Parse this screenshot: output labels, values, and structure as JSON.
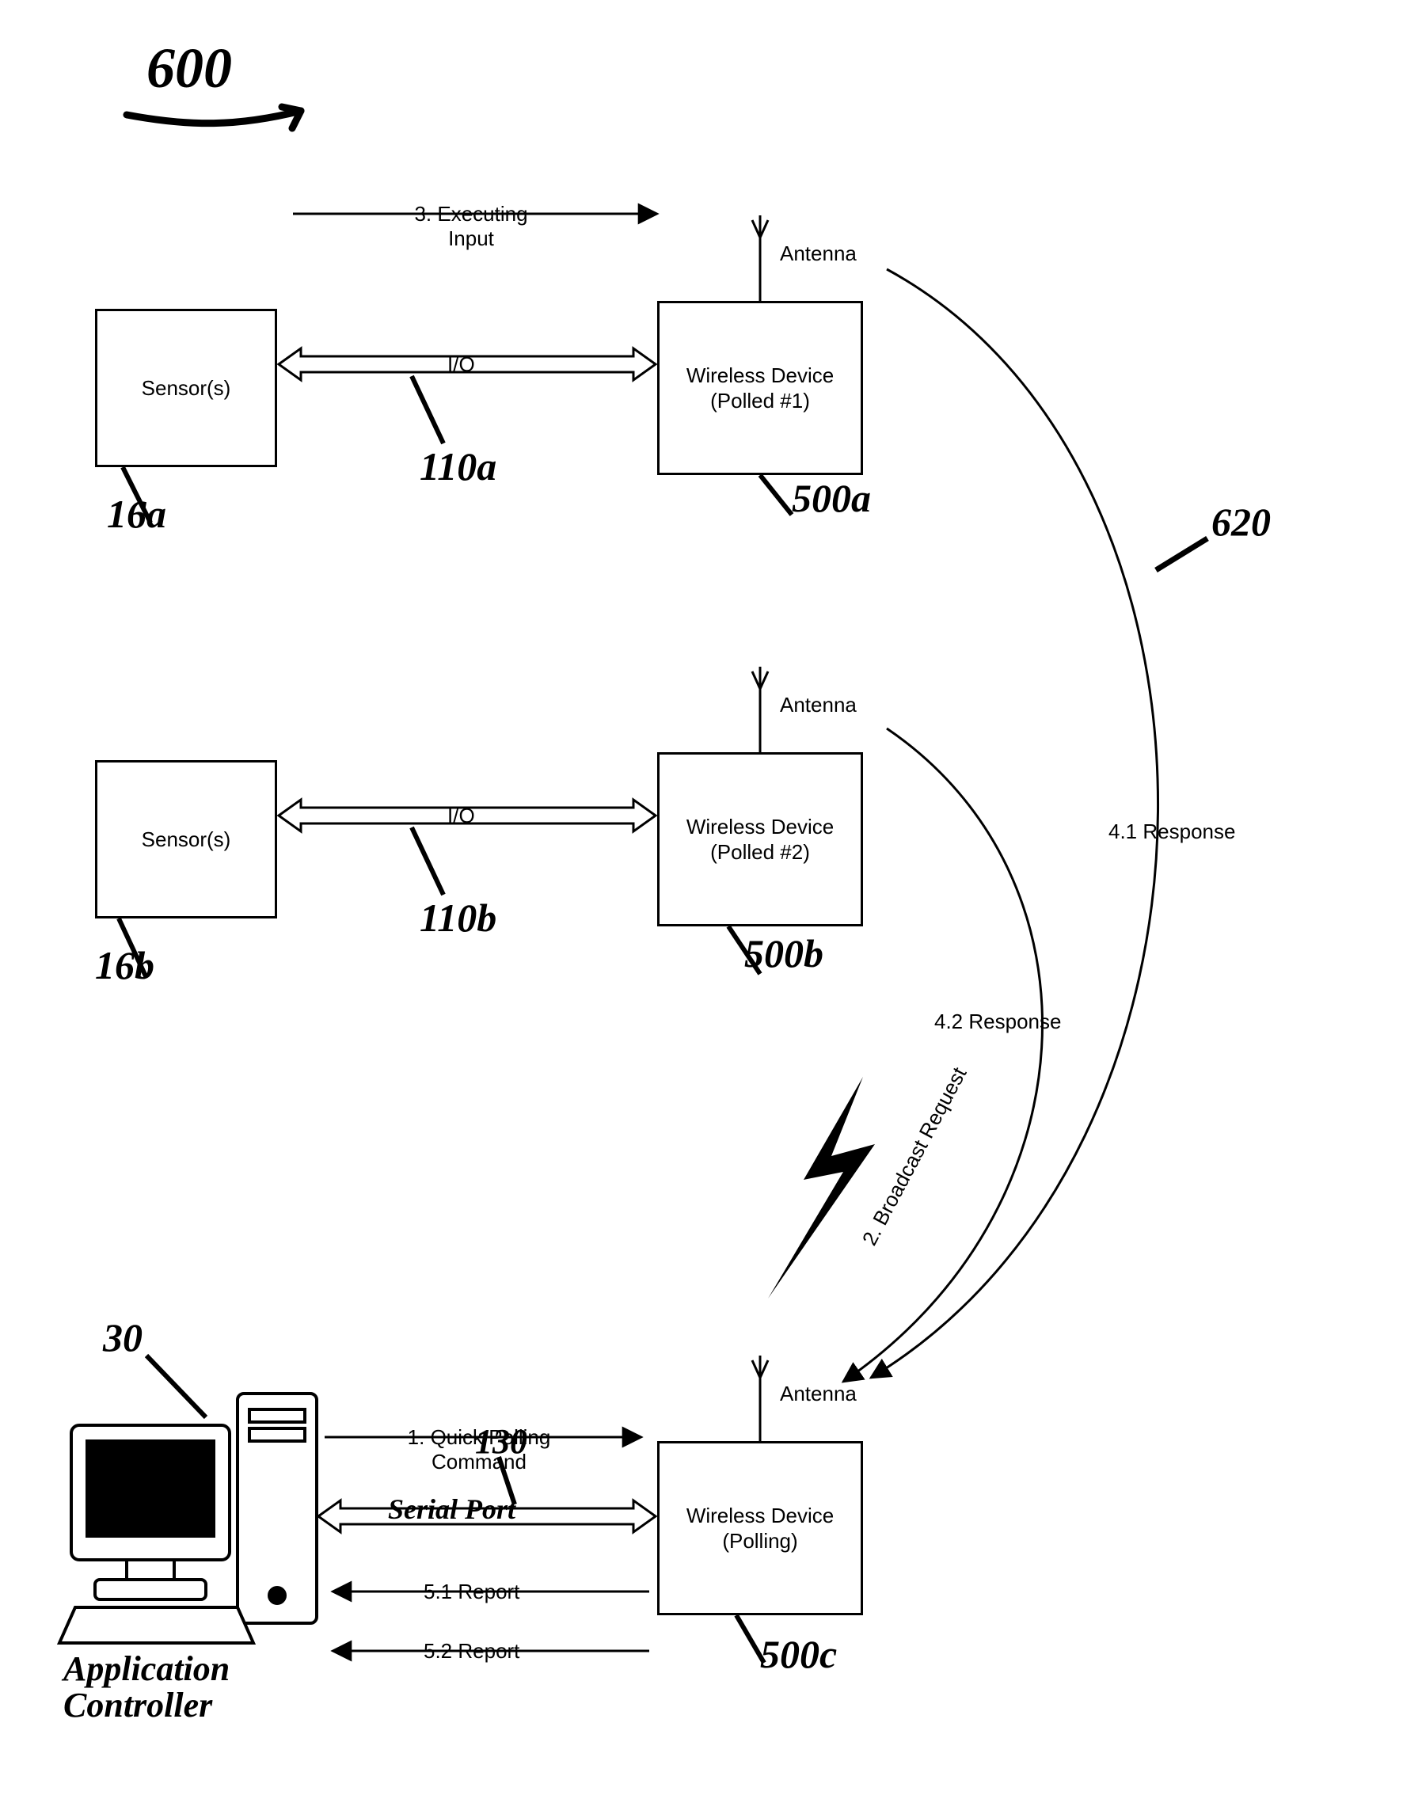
{
  "diagram_ref": "600",
  "nodes": {
    "sensor1": {
      "label": "Sensor(s)",
      "ref": "16a"
    },
    "sensor2": {
      "label": "Sensor(s)",
      "ref": "16b"
    },
    "device1": {
      "label": "Wireless Device\n(Polled #1)",
      "ref": "500a",
      "antenna_label": "Antenna"
    },
    "device2": {
      "label": "Wireless Device\n(Polled #2)",
      "ref": "500b",
      "antenna_label": "Antenna"
    },
    "device3": {
      "label": "Wireless Device\n(Polling)",
      "ref": "500c",
      "antenna_label": "Antenna"
    },
    "app_controller": {
      "label_hand": "Application\nController",
      "ref": "30"
    }
  },
  "links": {
    "io1": {
      "label": "I/O",
      "ref": "110a"
    },
    "io2": {
      "label": "I/O",
      "ref": "110b"
    },
    "serial": {
      "label_hand": "Serial Port",
      "ref": "130"
    }
  },
  "arrows": {
    "exec_input": {
      "label": "3. Executing\nInput"
    },
    "poll_cmd": {
      "label": "1. Quick Polling\nCommand"
    },
    "report1": {
      "label": "5.1 Report"
    },
    "report2": {
      "label": "5.2 Report"
    },
    "broadcast": {
      "label": "2. Broadcast Request"
    },
    "response1": {
      "label": "4.1 Response"
    },
    "response2": {
      "label": "4.2 Response"
    },
    "group_ref": "620"
  }
}
